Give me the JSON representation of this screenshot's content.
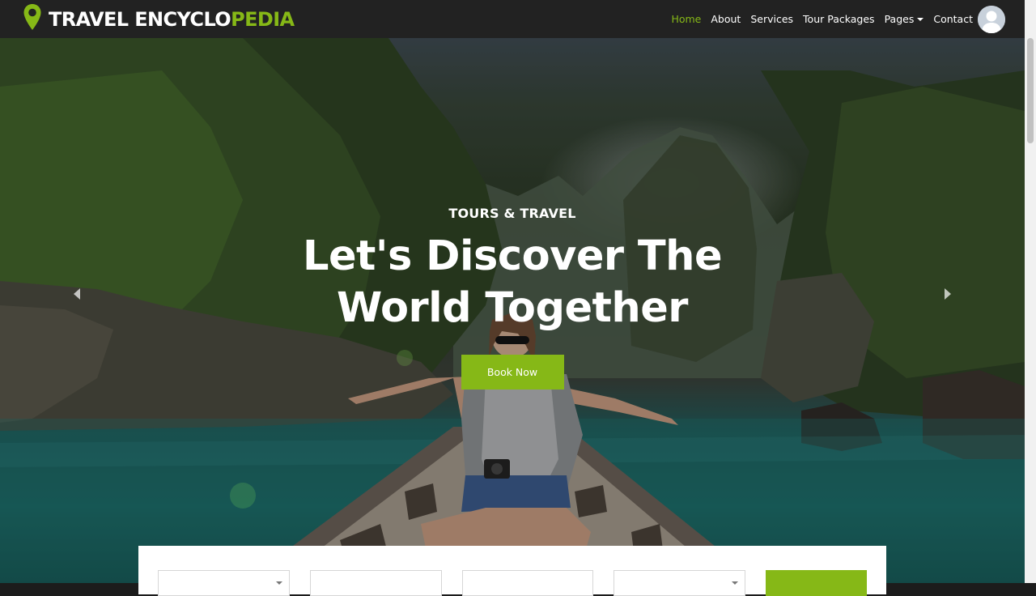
{
  "brand": {
    "name_main": "TRAVEL ENCYCLO",
    "name_accent": "PEDIA",
    "icon": "map-pin-icon",
    "accent_color": "#86b817"
  },
  "nav": {
    "items": [
      {
        "label": "Home",
        "active": true
      },
      {
        "label": "About",
        "active": false
      },
      {
        "label": "Services",
        "active": false
      },
      {
        "label": "Tour Packages",
        "active": false
      },
      {
        "label": "Pages",
        "active": false,
        "dropdown": true
      },
      {
        "label": "Contact",
        "active": false
      }
    ],
    "avatar_icon": "user-avatar-icon"
  },
  "hero": {
    "eyebrow": "TOURS & TRAVEL",
    "headline": "Let's Discover The World Together",
    "cta_label": "Book Now",
    "prev_icon": "chevron-left-icon",
    "next_icon": "chevron-right-icon"
  },
  "booking": {
    "fields": [
      {
        "value": "",
        "icon": "chevron-down-icon"
      },
      {
        "value": ""
      },
      {
        "value": ""
      },
      {
        "value": "",
        "icon": "chevron-down-icon"
      }
    ],
    "submit_label": ""
  },
  "colors": {
    "navbar_bg": "#222222",
    "accent": "#86b817",
    "text_light": "#ffffff"
  }
}
